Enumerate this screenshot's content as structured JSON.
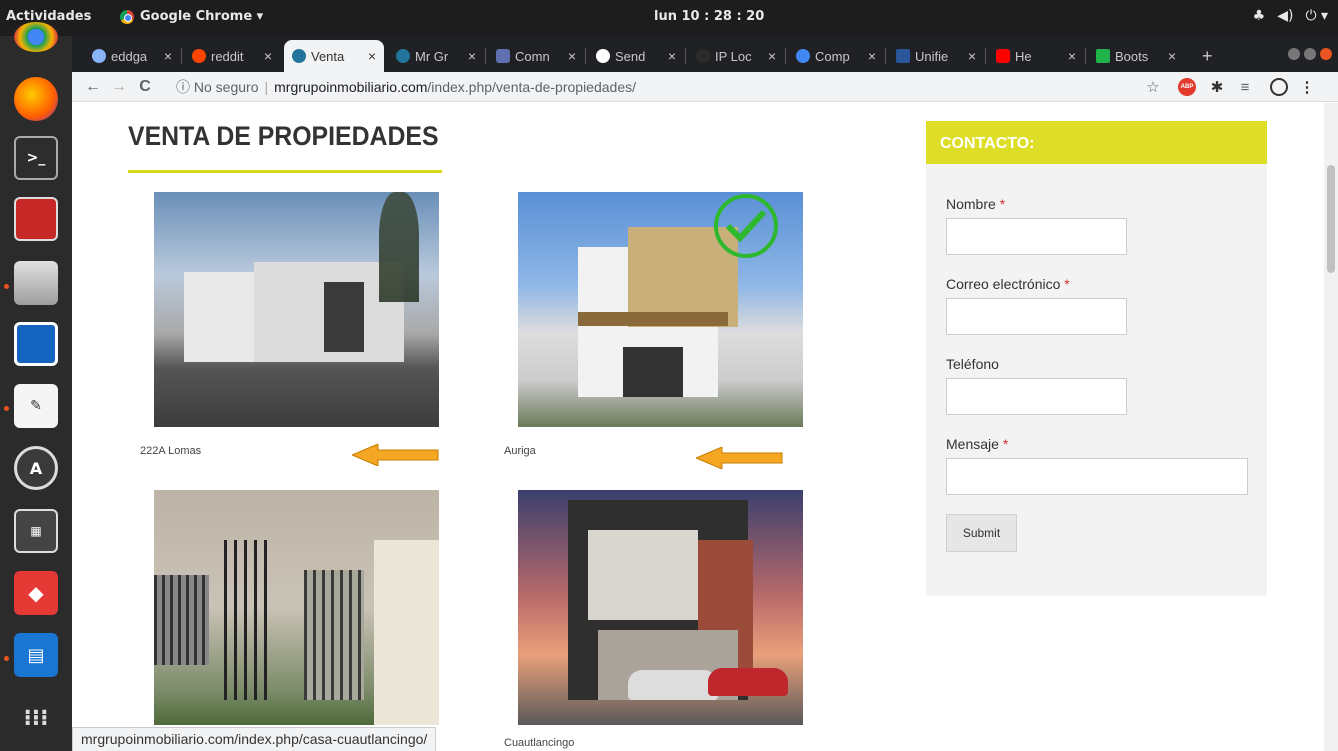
{
  "topbar": {
    "activities": "Actividades",
    "app_name": "Google Chrome ▾",
    "clock": "lun 10 : 28 : 20",
    "tray_network": "♣",
    "tray_volume": "◀)",
    "tray_power": "⏻ ▾"
  },
  "tabs": [
    {
      "label": "eddga",
      "color": "#8ab4f8"
    },
    {
      "label": "reddit",
      "color": "#ff4500"
    },
    {
      "label": "Venta",
      "color": "#21759b"
    },
    {
      "label": "Mr Gr",
      "color": "#21759b"
    },
    {
      "label": "Comn",
      "color": "#5f6fb0"
    },
    {
      "label": "Send",
      "color": "#ffffff"
    },
    {
      "label": "IP Loc",
      "color": "#2b2b2b"
    },
    {
      "label": "Comp",
      "color": "#4285f4"
    },
    {
      "label": "Unifie",
      "color": "#2b579a"
    },
    {
      "label": "He",
      "color": "#ff0000"
    },
    {
      "label": "Boots",
      "color": "#22b24c"
    }
  ],
  "tab_close": "×",
  "new_tab": "+",
  "addressbar": {
    "back": "←",
    "forward": "→",
    "reload": "C",
    "security": "ⓘ No seguro",
    "separator": "|",
    "host": "mrgrupoinmobiliario.com",
    "path": "/index.php/venta-de-propiedades/",
    "star": "☆",
    "abp": "ABP",
    "extensions": "✱",
    "menu": "⋮"
  },
  "page": {
    "title": "VENTA DE PROPIEDADES",
    "properties": [
      {
        "caption": "222A Lomas"
      },
      {
        "caption": "Auriga"
      },
      {
        "caption": ""
      },
      {
        "caption": "Cuautlancingo"
      }
    ]
  },
  "contact": {
    "heading": "CONTACTO:",
    "name_label": "Nombre",
    "email_label": "Correo electrónico",
    "phone_label": "Teléfono",
    "message_label": "Mensaje",
    "required_mark": "*",
    "submit": "Submit"
  },
  "status_url": "mrgrupoinmobiliario.com/index.php/casa-cuautlancingo/",
  "colors": {
    "accent_yellow": "#dede28",
    "arrow_orange": "#f5a623"
  }
}
